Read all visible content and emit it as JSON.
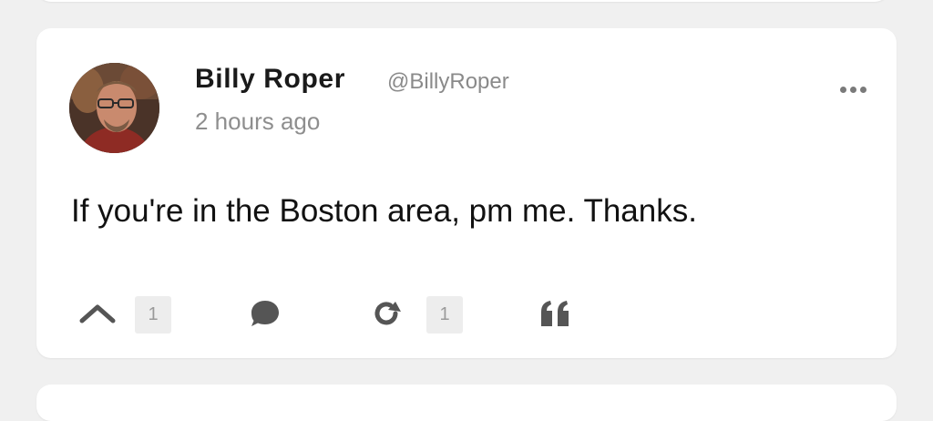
{
  "post": {
    "author_name": "Billy Roper",
    "author_handle": "@BillyRoper",
    "timestamp": "2 hours ago",
    "text": "If you're in the Boston area, pm me. Thanks.",
    "upvote_count": "1",
    "repost_count": "1"
  },
  "icons": {
    "avatar": "profile-photo",
    "more": "more-options-icon",
    "upvote": "chevron-up-icon",
    "comment": "speech-bubble-icon",
    "repost": "refresh-icon",
    "quote": "quote-icon"
  },
  "colors": {
    "background": "#f0f0f0",
    "card": "#ffffff",
    "text": "#111111",
    "muted": "#8e8e8e",
    "icon": "#555555",
    "badge": "#ededed"
  }
}
